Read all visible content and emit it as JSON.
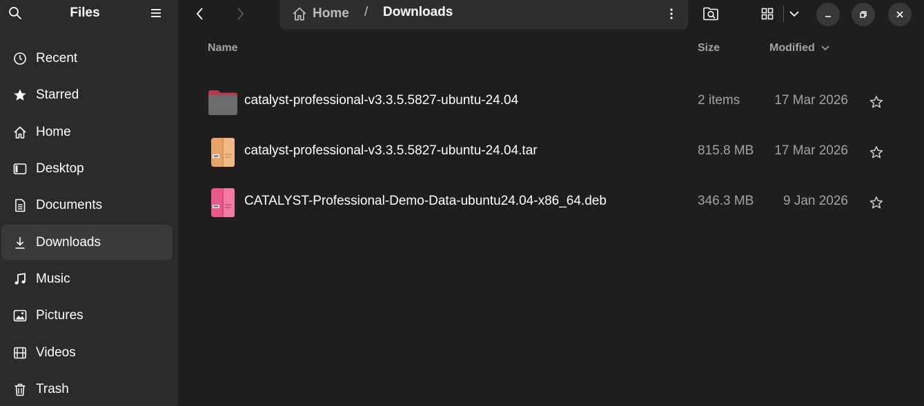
{
  "sidebar": {
    "title": "Files",
    "search_icon": "search-icon",
    "menu_icon": "hamburger-menu-icon",
    "items": [
      {
        "label": "Recent",
        "icon": "clock-icon"
      },
      {
        "label": "Starred",
        "icon": "star-icon"
      },
      {
        "label": "Home",
        "icon": "home-icon"
      },
      {
        "label": "Desktop",
        "icon": "desktop-icon"
      },
      {
        "label": "Documents",
        "icon": "document-icon"
      },
      {
        "label": "Downloads",
        "icon": "download-icon",
        "active": true
      },
      {
        "label": "Music",
        "icon": "music-icon"
      },
      {
        "label": "Pictures",
        "icon": "picture-icon"
      },
      {
        "label": "Videos",
        "icon": "video-icon"
      },
      {
        "label": "Trash",
        "icon": "trash-icon"
      }
    ]
  },
  "pathbar": {
    "home_label": "Home",
    "separator": "/",
    "current": "Downloads"
  },
  "columns": {
    "name": "Name",
    "size": "Size",
    "modified": "Modified"
  },
  "files": [
    {
      "name": "catalyst-professional-v3.3.5.5827-ubuntu-24.04",
      "size": "2 items",
      "modified": "17 Mar 2026",
      "icon": "folder-icon"
    },
    {
      "name": "catalyst-professional-v3.3.5.5827-ubuntu-24.04.tar",
      "size": "815.8 MB",
      "modified": "17 Mar 2026",
      "icon": "archive-icon"
    },
    {
      "name": "CATALYST-Professional-Demo-Data-ubuntu24.04-x86_64.deb",
      "size": "346.3 MB",
      "modified": "9 Jan 2026",
      "icon": "package-icon"
    }
  ],
  "colors": {
    "sidebar_bg": "#2b2b2b",
    "main_bg": "#1e1e1e",
    "folder": "#6b6b6b",
    "folder_tab": "#b5394f",
    "archive": "#e6a46a",
    "package": "#e9578a"
  }
}
